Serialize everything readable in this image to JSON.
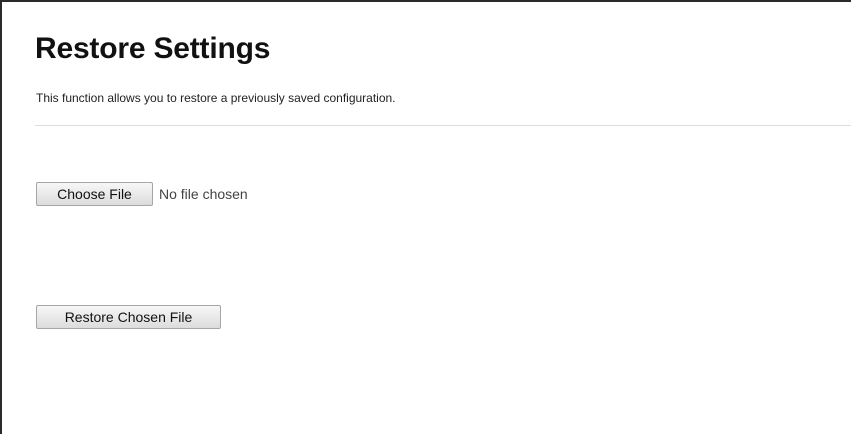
{
  "page": {
    "title": "Restore Settings",
    "description": "This function allows you to restore a previously saved configuration."
  },
  "file_input": {
    "button_label": "Choose File",
    "status_text": "No file chosen"
  },
  "actions": {
    "restore_label": "Restore Chosen File"
  }
}
